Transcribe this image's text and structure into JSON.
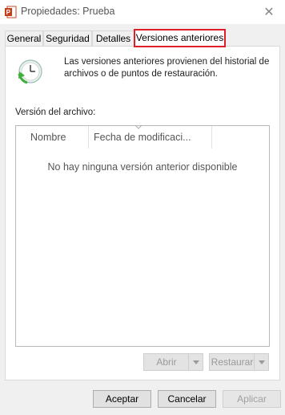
{
  "window": {
    "title": "Propiedades: Prueba",
    "close_glyph": "✕"
  },
  "tabs": [
    {
      "label": "General"
    },
    {
      "label": "Seguridad"
    },
    {
      "label": "Detalles"
    },
    {
      "label": "Versiones anteriores",
      "active": true
    }
  ],
  "panel": {
    "description": "Las versiones anteriores provienen del historial de archivos o de puntos de restauración.",
    "section_label": "Versión del archivo:",
    "columns": [
      "Nombre",
      "Fecha de modificaci..."
    ],
    "empty_message": "No hay ninguna versión anterior disponible",
    "buttons": {
      "open": "Abrir",
      "restore": "Restaurar"
    }
  },
  "footer": {
    "accept": "Aceptar",
    "cancel": "Cancelar",
    "apply": "Aplicar"
  },
  "colors": {
    "active_tab_border": "#e01e2a",
    "history_icon_green": "#3fae3c"
  }
}
